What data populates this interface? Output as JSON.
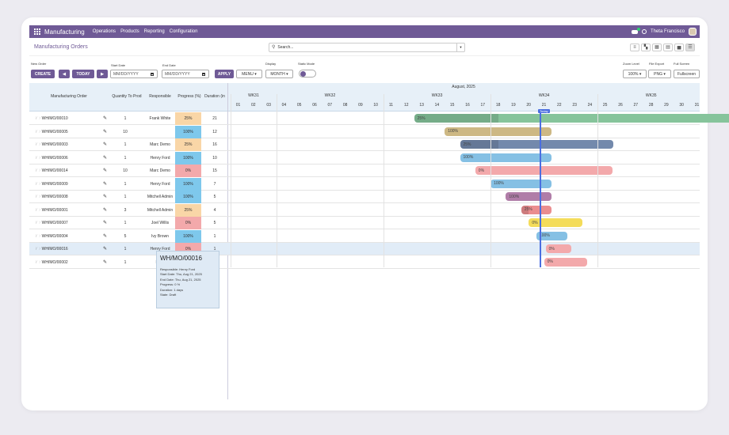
{
  "nav": {
    "app_name": "Manufacturing",
    "menu": [
      "Operations",
      "Products",
      "Reporting",
      "Configuration"
    ],
    "user_name": "Theta Francisco"
  },
  "control": {
    "breadcrumb": "Manufacturing Orders",
    "search_placeholder": "Search..."
  },
  "toolbar": {
    "new_order_label": "New Order",
    "create": "CREATE",
    "today": "TODAY",
    "start_date_label": "Start Date",
    "end_date_label": "End Date",
    "date_placeholder": "MM/DD/YYYY",
    "apply": "APPLY",
    "menu": "MENU",
    "display_label": "Display",
    "display_value": "MONTH",
    "static_mode_label": "Static Mode",
    "zoom_label": "Zoom Level",
    "zoom_value": "100%",
    "export_label": "File Export",
    "export_value": "PNG",
    "fullscreen_label": "Full Screen",
    "fullscreen": "Fullscreen"
  },
  "grid": {
    "columns": [
      "Manufacturing Order",
      "Quantity To Prod",
      "Responsible",
      "Progress (%)",
      "Duration (in"
    ],
    "month": "August, 2025",
    "weeks": [
      "WK31",
      "WK32",
      "WK33",
      "WK34",
      "WK35"
    ],
    "days": [
      "01",
      "02",
      "03",
      "04",
      "05",
      "06",
      "07",
      "08",
      "09",
      "10",
      "11",
      "12",
      "13",
      "14",
      "15",
      "16",
      "17",
      "18",
      "19",
      "20",
      "21",
      "22",
      "23",
      "24",
      "25",
      "26",
      "27",
      "28",
      "29",
      "30",
      "31"
    ],
    "today_label": "Today",
    "rows": [
      {
        "name": "WH/MO/00010",
        "qty": "1",
        "resp": "Frank White",
        "prog": "25%",
        "dur": "21",
        "start": 13,
        "end": 34,
        "color": "#86c49b",
        "pcolor": "#f9d6a7",
        "plabel": "25%"
      },
      {
        "name": "WH/MO/00005",
        "qty": "10",
        "resp": "",
        "prog": "100%",
        "dur": "12",
        "start": 15,
        "end": 21,
        "color": "#cdb884",
        "pcolor": "#7ec8ec",
        "plabel": "100%"
      },
      {
        "name": "WH/MO/00003",
        "qty": "1",
        "resp": "Marc Demo",
        "prog": "25%",
        "dur": "16",
        "start": 16,
        "end": 25,
        "color": "#7389ac",
        "pcolor": "#f9d6a7",
        "plabel": "25%"
      },
      {
        "name": "WH/MO/00006",
        "qty": "1",
        "resp": "Henry Ford",
        "prog": "100%",
        "dur": "10",
        "start": 16,
        "end": 21,
        "color": "#85c0e4",
        "pcolor": "#7ec8ec",
        "plabel": "100%"
      },
      {
        "name": "WH/MO/00014",
        "qty": "10",
        "resp": "Marc Demo",
        "prog": "0%",
        "dur": "15",
        "start": 17,
        "end": 25,
        "color": "#f3a9ab",
        "pcolor": "#f3a9ab",
        "plabel": "0%"
      },
      {
        "name": "WH/MO/00009",
        "qty": "1",
        "resp": "Henry Ford",
        "prog": "100%",
        "dur": "7",
        "start": 18,
        "end": 21,
        "color": "#85c0e4",
        "pcolor": "#7ec8ec",
        "plabel": "100%"
      },
      {
        "name": "WH/MO/00008",
        "qty": "1",
        "resp": "Mitchell Admin",
        "prog": "100%",
        "dur": "5",
        "start": 19,
        "end": 21,
        "color": "#b07da8",
        "pcolor": "#7ec8ec",
        "plabel": "100%"
      },
      {
        "name": "WH/MO/00001",
        "qty": "3",
        "resp": "Mitchell Admin",
        "prog": "25%",
        "dur": "4",
        "start": 20,
        "end": 21,
        "color": "#ea8d8f",
        "pcolor": "#f9d6a7",
        "plabel": "25%"
      },
      {
        "name": "WH/MO/00007",
        "qty": "1",
        "resp": "Joel Willis",
        "prog": "0%",
        "dur": "5",
        "start": 20.5,
        "end": 23,
        "color": "#f4dc5a",
        "pcolor": "#f3a9ab",
        "plabel": "0%"
      },
      {
        "name": "WH/MO/00004",
        "qty": "5",
        "resp": "Ivy Brown",
        "prog": "100%",
        "dur": "1",
        "start": 21,
        "end": 22,
        "color": "#85c0e4",
        "pcolor": "#7ec8ec",
        "plabel": "100%"
      },
      {
        "name": "WH/MO/00016",
        "qty": "1",
        "resp": "Henry Ford",
        "prog": "0%",
        "dur": "1",
        "start": 21.6,
        "end": 22.3,
        "color": "#f3a9ab",
        "pcolor": "#f3a9ab",
        "plabel": "0%"
      },
      {
        "name": "WH/MO/00002",
        "qty": "1",
        "resp": "Marc",
        "prog": "0%",
        "dur": "1",
        "start": 21.5,
        "end": 23.3,
        "color": "#f3a9ab",
        "pcolor": "#f3a9ab",
        "plabel": "0%"
      }
    ]
  },
  "tooltip": {
    "title": "WH/MO/00016",
    "responsible": "Responsible: Henry Ford",
    "start": "Start Date: Thu, Aug 21, 2025",
    "end": "End Date: Thu, Aug 21, 2025",
    "progress": "Progress: 0 %",
    "duration": "Duration: 1 days",
    "state": "State: Draft"
  }
}
